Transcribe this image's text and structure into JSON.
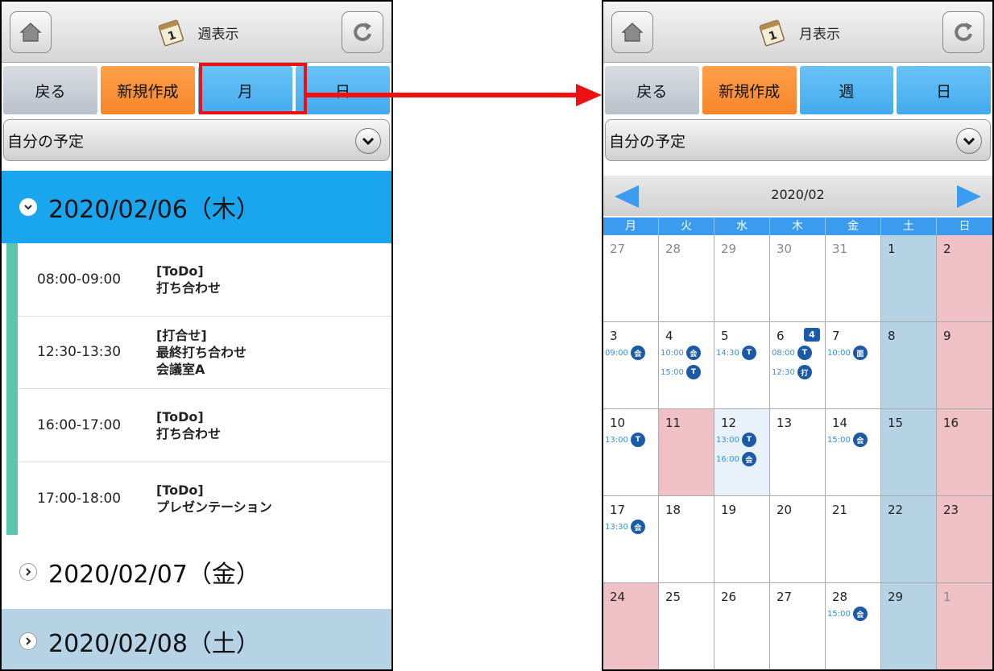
{
  "left": {
    "title": "週表示",
    "buttons": [
      "戻る",
      "新規作成",
      "月",
      "日"
    ],
    "dropdown": "自分の予定",
    "days": [
      {
        "date": "2020/02/06（木）"
      },
      {
        "date": "2020/02/07（金）"
      },
      {
        "date": "2020/02/08（土）"
      }
    ],
    "events": [
      {
        "time": "08:00-09:00",
        "lines": [
          "[ToDo]",
          "打ち合わせ"
        ]
      },
      {
        "time": "12:30-13:30",
        "lines": [
          "[打合せ]",
          "最終打ち合わせ",
          "会議室A"
        ]
      },
      {
        "time": "16:00-17:00",
        "lines": [
          "[ToDo]",
          "打ち合わせ"
        ]
      },
      {
        "time": "17:00-18:00",
        "lines": [
          "[ToDo]",
          "プレゼンテーション"
        ]
      }
    ]
  },
  "right": {
    "title": "月表示",
    "buttons": [
      "戻る",
      "新規作成",
      "週",
      "日"
    ],
    "dropdown": "自分の予定",
    "month": "2020/02",
    "weekdays": [
      "月",
      "火",
      "水",
      "木",
      "金",
      "土",
      "日"
    ],
    "cells": [
      {
        "d": "27",
        "dim": true
      },
      {
        "d": "28",
        "dim": true
      },
      {
        "d": "29",
        "dim": true
      },
      {
        "d": "30",
        "dim": true
      },
      {
        "d": "31",
        "dim": true
      },
      {
        "d": "1"
      },
      {
        "d": "2"
      },
      {
        "d": "3",
        "ev": [
          {
            "t": "09:00",
            "i": "会"
          }
        ]
      },
      {
        "d": "4",
        "ev": [
          {
            "t": "10:00",
            "i": "会"
          },
          {
            "t": "15:00",
            "i": "T"
          }
        ]
      },
      {
        "d": "5",
        "ev": [
          {
            "t": "14:30",
            "i": "T"
          }
        ]
      },
      {
        "d": "6",
        "count": "4",
        "ev": [
          {
            "t": "08:00",
            "i": "T"
          },
          {
            "t": "12:30",
            "i": "打"
          }
        ]
      },
      {
        "d": "7",
        "ev": [
          {
            "t": "10:00",
            "i": "面"
          }
        ]
      },
      {
        "d": "8"
      },
      {
        "d": "9"
      },
      {
        "d": "10",
        "ev": [
          {
            "t": "13:00",
            "i": "T"
          }
        ]
      },
      {
        "d": "11",
        "hol": true
      },
      {
        "d": "12",
        "today": true,
        "ev": [
          {
            "t": "13:00",
            "i": "T"
          },
          {
            "t": "16:00",
            "i": "会"
          }
        ]
      },
      {
        "d": "13"
      },
      {
        "d": "14",
        "ev": [
          {
            "t": "15:00",
            "i": "会"
          }
        ]
      },
      {
        "d": "15"
      },
      {
        "d": "16"
      },
      {
        "d": "17",
        "ev": [
          {
            "t": "13:30",
            "i": "会"
          }
        ]
      },
      {
        "d": "18"
      },
      {
        "d": "19"
      },
      {
        "d": "20"
      },
      {
        "d": "21"
      },
      {
        "d": "22"
      },
      {
        "d": "23"
      },
      {
        "d": "24",
        "hol": true
      },
      {
        "d": "25"
      },
      {
        "d": "26"
      },
      {
        "d": "27"
      },
      {
        "d": "28",
        "ev": [
          {
            "t": "15:00",
            "i": "会"
          }
        ]
      },
      {
        "d": "29"
      },
      {
        "d": "1",
        "dim": true
      }
    ]
  },
  "colors": {
    "accent_blue": "#1aa6ee",
    "orange": "#f5852a",
    "highlight_red": "#ee1111",
    "saturday": "#b6d3e6",
    "sunday": "#efc0c6"
  }
}
